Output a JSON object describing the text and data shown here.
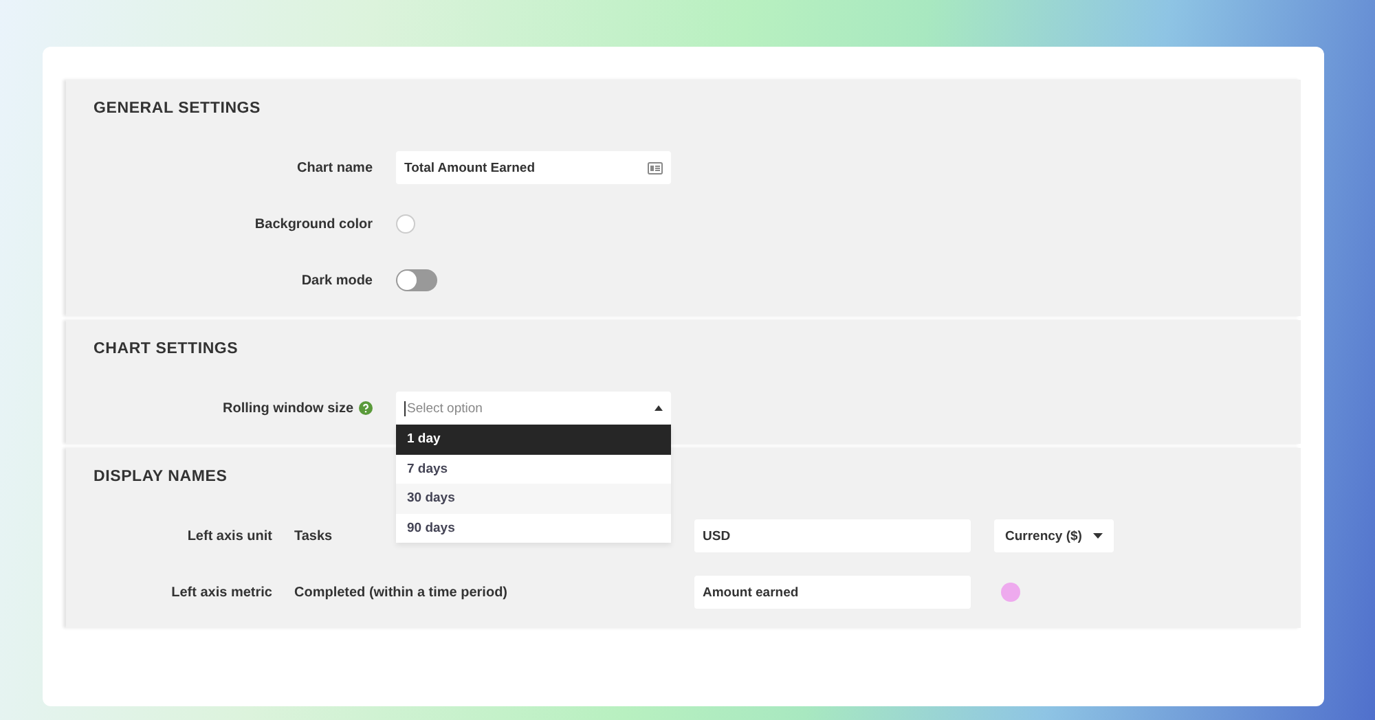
{
  "sections": [
    {
      "title": "GENERAL SETTINGS",
      "rows": [
        {
          "kind": "text",
          "label": "Chart name",
          "value": "Total Amount Earned"
        },
        {
          "kind": "color",
          "label": "Background color",
          "color": "#ffffff"
        },
        {
          "kind": "toggle",
          "label": "Dark mode",
          "on": false
        }
      ]
    },
    {
      "title": "CHART SETTINGS",
      "rows": [
        {
          "kind": "select",
          "label": "Rolling window size",
          "placeholder": "Select option",
          "expanded": true,
          "options": [
            {
              "label": "1 day",
              "selected": true
            },
            {
              "label": "7 days",
              "selected": false
            },
            {
              "label": "30 days",
              "selected": false
            },
            {
              "label": "90 days",
              "selected": false
            }
          ]
        }
      ]
    },
    {
      "title": "DISPLAY NAMES",
      "rows": [
        {
          "kind": "display",
          "label": "Left axis unit",
          "name": "Tasks",
          "value": "USD",
          "extra": {
            "kind": "dropdown",
            "value": "Currency ($)"
          }
        },
        {
          "kind": "display",
          "label": "Left axis metric",
          "name": "Completed (within a time period)",
          "value": "Amount earned",
          "extra": {
            "kind": "color",
            "color": "#eeaaee"
          }
        }
      ]
    }
  ]
}
